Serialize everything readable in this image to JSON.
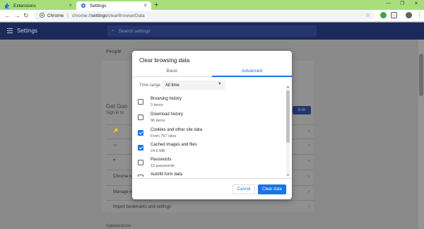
{
  "browser": {
    "tabs": [
      {
        "title": "Extensions",
        "icon": "puzzle-icon",
        "active": false
      },
      {
        "title": "Settings",
        "icon": "gear-icon",
        "active": true
      }
    ],
    "omnibox": {
      "chip": "Chrome",
      "scheme": "chrome://",
      "host": "settings",
      "path": "/clearBrowserData"
    },
    "accent": "#a8de7a"
  },
  "settings": {
    "title": "Settings",
    "search_placeholder": "Search settings",
    "section_people": "People",
    "get_google": "Get Goo",
    "sign_in_to": "Sign in to",
    "sign_in_btn": "n in",
    "row_chrome_name": "Chrome name",
    "row_manage": "Manage ot",
    "row_import": "Import bookmarks and settings",
    "section_appearance": "Appearance",
    "header_color": "#1b2a5a"
  },
  "dialog": {
    "title": "Clear browsing data",
    "tabs": [
      {
        "label": "Basic",
        "active": false
      },
      {
        "label": "Advanced",
        "active": true
      }
    ],
    "time_range_label": "Time range",
    "time_range_value": "All time",
    "items": [
      {
        "title": "Browsing history",
        "subtitle": "3 items",
        "checked": false
      },
      {
        "title": "Download history",
        "subtitle": "96 items",
        "checked": false
      },
      {
        "title": "Cookies and other site data",
        "subtitle": "From 757 sites",
        "checked": true
      },
      {
        "title": "Cached images and files",
        "subtitle": "24.5 MB",
        "checked": true
      },
      {
        "title": "Passwords",
        "subtitle": "12 passwords",
        "checked": false
      },
      {
        "title": "Autofill form data",
        "subtitle": "",
        "checked": false
      }
    ],
    "cancel_label": "Cancel",
    "clear_label": "Clear data",
    "primary_color": "#1a73e8"
  }
}
